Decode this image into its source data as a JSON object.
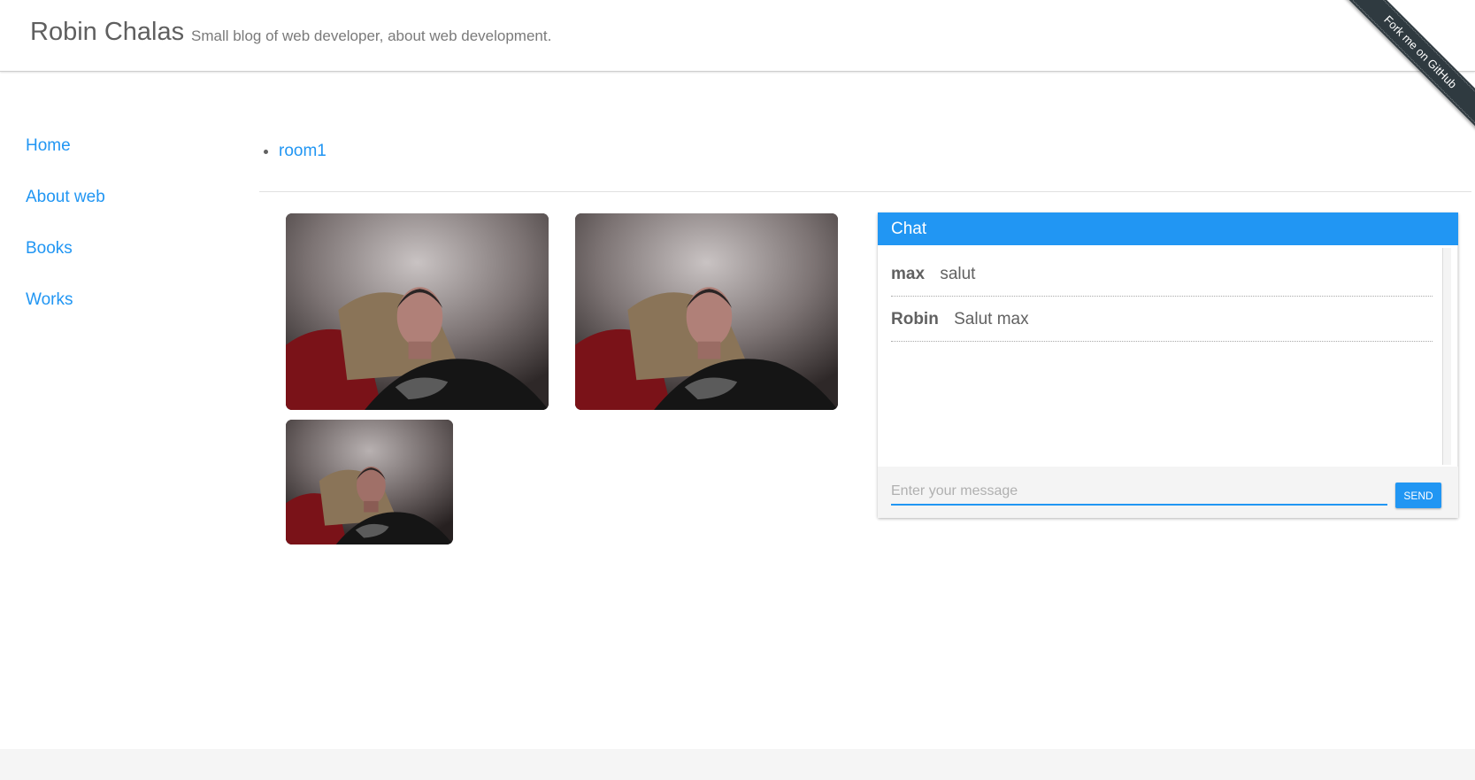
{
  "header": {
    "title": "Robin Chalas",
    "tagline": "Small blog of web developer, about web development.",
    "ribbon": "Fork me on GitHub"
  },
  "sidebar": {
    "items": [
      {
        "label": "Home"
      },
      {
        "label": "About web"
      },
      {
        "label": "Books"
      },
      {
        "label": "Works"
      }
    ]
  },
  "rooms": [
    {
      "label": "room1"
    }
  ],
  "videos": [
    {
      "name": "remote-video-1"
    },
    {
      "name": "remote-video-2"
    },
    {
      "name": "local-video"
    }
  ],
  "chat": {
    "title": "Chat",
    "messages": [
      {
        "author": "max",
        "text": "salut"
      },
      {
        "author": "Robin",
        "text": "Salut max"
      }
    ],
    "input_value": "",
    "input_placeholder": "Enter your message",
    "send_label": "SEND"
  },
  "colors": {
    "accent": "#2196f3",
    "text": "#616161",
    "ribbon": "#2f3a40"
  }
}
